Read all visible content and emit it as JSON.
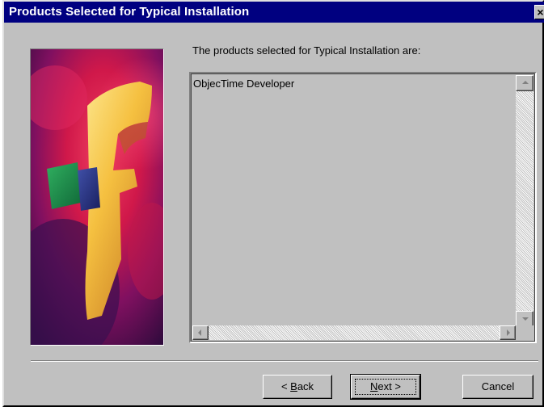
{
  "window": {
    "title": "Products Selected for Typical Installation",
    "close_glyph": "×"
  },
  "content": {
    "heading": "The products selected for Typical Installation are:",
    "products": [
      "ObjecTime Developer"
    ]
  },
  "artwork": {
    "icon": "installer-graphic",
    "colors": [
      "#e0204a",
      "#f0c850",
      "#208a50",
      "#304090",
      "#301040"
    ]
  },
  "buttons": {
    "back": {
      "prefix": "< ",
      "mnemonic": "B",
      "rest": "ack"
    },
    "next": {
      "mnemonic": "N",
      "rest": "ext >"
    },
    "cancel": "Cancel"
  },
  "theme": {
    "title_bar": "#000080",
    "face": "#c0c0c0"
  }
}
